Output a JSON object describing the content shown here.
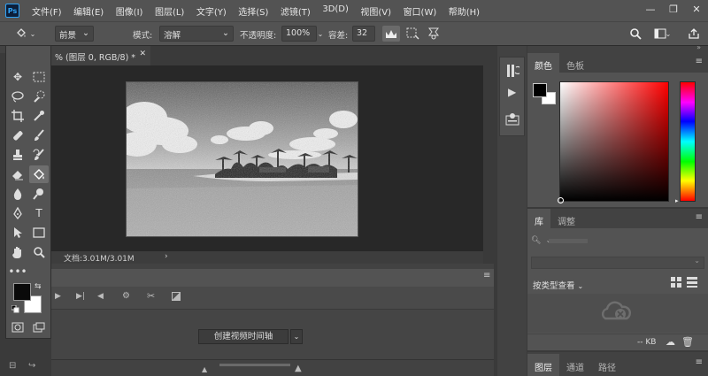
{
  "app": {
    "logo": "Ps"
  },
  "menu": {
    "items": [
      "文件(F)",
      "编辑(E)",
      "图像(I)",
      "图层(L)",
      "文字(Y)",
      "选择(S)",
      "滤镜(T)",
      "3D(D)",
      "视图(V)",
      "窗口(W)",
      "帮助(H)"
    ]
  },
  "window_controls": {
    "minimize": "—",
    "restore": "❐",
    "close": "✕"
  },
  "options": {
    "fill_source": "前景",
    "mode_label": "模式:",
    "mode_value": "溶解",
    "opacity_label": "不透明度:",
    "opacity_value": "100%",
    "tolerance_label": "容差:",
    "tolerance_value": "32"
  },
  "document": {
    "tab_title": "% (图层 0, RGB/8) *",
    "status": "文档:3.01M/3.01M"
  },
  "timeline": {
    "create_button": "创建视频时间轴"
  },
  "color_panel": {
    "tabs": [
      "颜色",
      "色板"
    ],
    "foreground": "#000000",
    "background": "#ffffff"
  },
  "library_panel": {
    "tabs": [
      "库",
      "调整"
    ],
    "view_label": "按类型查看",
    "size_label": "-- KB"
  },
  "layers_panel": {
    "tabs": [
      "图层",
      "通道",
      "路径"
    ]
  },
  "toolbar": {
    "foreground": "#0a0a0a",
    "background": "#ffffff"
  }
}
